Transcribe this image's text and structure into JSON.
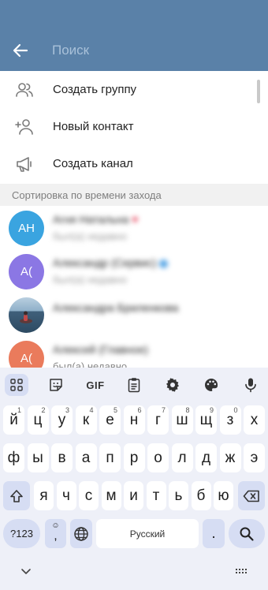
{
  "header": {
    "search_placeholder": "Поиск"
  },
  "actions": [
    {
      "label": "Создать группу",
      "icon": "group-icon"
    },
    {
      "label": "Новый контакт",
      "icon": "add-contact-icon"
    },
    {
      "label": "Создать канал",
      "icon": "megaphone-icon"
    }
  ],
  "section_title": "Сортировка по времени захода",
  "contacts": [
    {
      "initials": "АН",
      "name": "Агня Натальна",
      "status": "был(а) недавно",
      "color": "#3aa4e0"
    },
    {
      "initials": "А(",
      "name": "Александр (Сервис)",
      "status": "был(а) недавно",
      "color": "#8b77e4"
    },
    {
      "initials": "",
      "name": "Александра Бриленкова",
      "status": "",
      "color": "#4d6b82"
    },
    {
      "initials": "А(",
      "name": "Алексей (Главное)",
      "status": "был(а) недавно",
      "color": "#ea7b5c"
    }
  ],
  "keyboard": {
    "toolbar": {
      "gif_label": "GIF"
    },
    "row1": [
      {
        "k": "й",
        "s": "1"
      },
      {
        "k": "ц",
        "s": "2"
      },
      {
        "k": "у",
        "s": "3"
      },
      {
        "k": "к",
        "s": "4"
      },
      {
        "k": "е",
        "s": "5"
      },
      {
        "k": "н",
        "s": "6"
      },
      {
        "k": "г",
        "s": "7"
      },
      {
        "k": "ш",
        "s": "8"
      },
      {
        "k": "щ",
        "s": "9"
      },
      {
        "k": "з",
        "s": "0"
      },
      {
        "k": "х",
        "s": ""
      }
    ],
    "row2": [
      "ф",
      "ы",
      "в",
      "а",
      "п",
      "р",
      "о",
      "л",
      "д",
      "ж",
      "э"
    ],
    "row3": [
      "я",
      "ч",
      "с",
      "м",
      "и",
      "т",
      "ь",
      "б",
      "ю"
    ],
    "symbols_label": "?123",
    "comma_label": ",",
    "space_label": "Русский",
    "period_label": "."
  },
  "colors": {
    "header": "#5a81a8",
    "keyboard_bg": "#eef0f8",
    "accent_key": "#d6ddf3"
  }
}
